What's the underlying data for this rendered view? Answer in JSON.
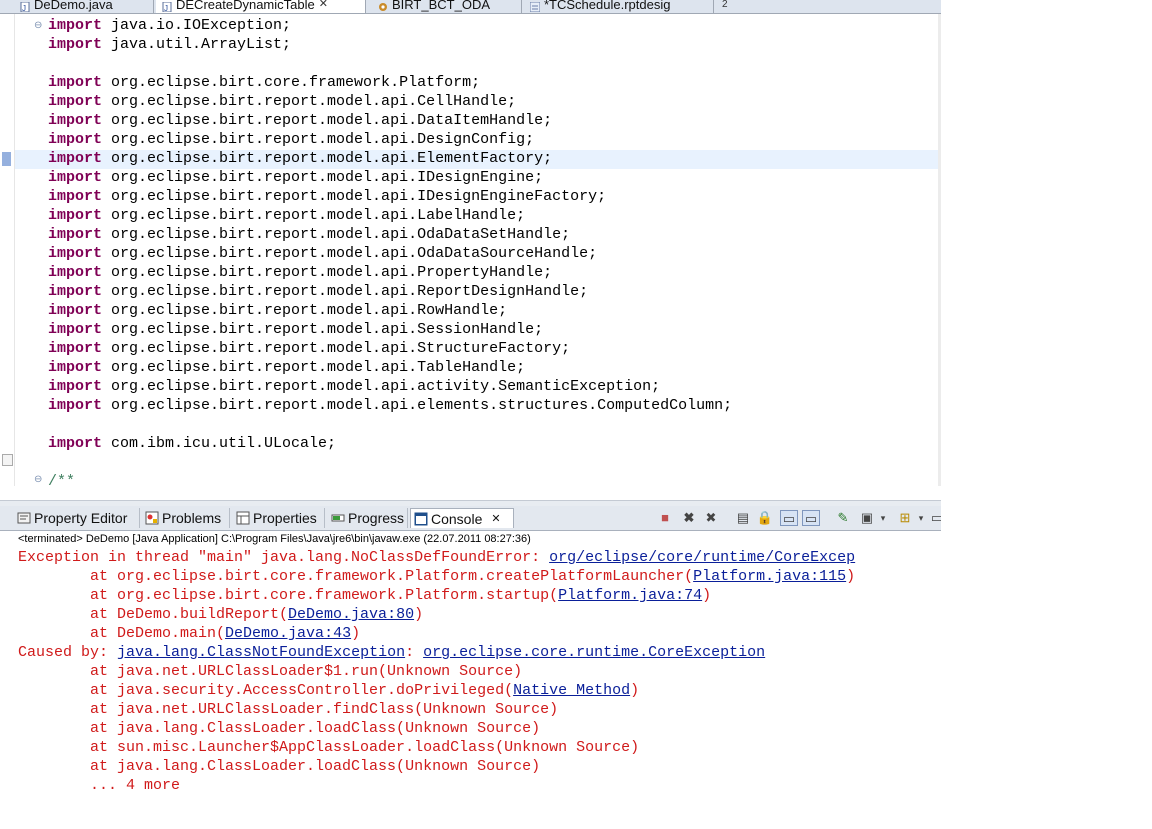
{
  "editor_tabs": [
    {
      "label": "DeDemo.java",
      "icon": "java-file-icon",
      "active": false
    },
    {
      "label": "DECreateDynamicTable",
      "icon": "java-file-icon",
      "active": true,
      "close": "✕"
    },
    {
      "label": "BIRT_BCT_ODA",
      "icon": "gear-icon",
      "active": false
    },
    {
      "label": "*TCSchedule.rptdesig",
      "icon": "report-design-icon",
      "active": false
    },
    {
      "label": "2",
      "icon": "",
      "active": false
    }
  ],
  "code": {
    "keyword": "import",
    "lines": [
      {
        "kw": "import",
        "text": " java.io.IOException;"
      },
      {
        "kw": "import",
        "text": " java.util.ArrayList;"
      },
      {
        "kw": "",
        "text": ""
      },
      {
        "kw": "import",
        "text": " org.eclipse.birt.core.framework.Platform;"
      },
      {
        "kw": "import",
        "text": " org.eclipse.birt.report.model.api.CellHandle;"
      },
      {
        "kw": "import",
        "text": " org.eclipse.birt.report.model.api.DataItemHandle;"
      },
      {
        "kw": "import",
        "text": " org.eclipse.birt.report.model.api.DesignConfig;"
      },
      {
        "kw": "import",
        "text": " org.eclipse.birt.report.model.api.ElementFactory;"
      },
      {
        "kw": "import",
        "text": " org.eclipse.birt.report.model.api.IDesignEngine;"
      },
      {
        "kw": "import",
        "text": " org.eclipse.birt.report.model.api.IDesignEngineFactory;"
      },
      {
        "kw": "import",
        "text": " org.eclipse.birt.report.model.api.LabelHandle;"
      },
      {
        "kw": "import",
        "text": " org.eclipse.birt.report.model.api.OdaDataSetHandle;"
      },
      {
        "kw": "import",
        "text": " org.eclipse.birt.report.model.api.OdaDataSourceHandle;"
      },
      {
        "kw": "import",
        "text": " org.eclipse.birt.report.model.api.PropertyHandle;"
      },
      {
        "kw": "import",
        "text": " org.eclipse.birt.report.model.api.ReportDesignHandle;"
      },
      {
        "kw": "import",
        "text": " org.eclipse.birt.report.model.api.RowHandle;"
      },
      {
        "kw": "import",
        "text": " org.eclipse.birt.report.model.api.SessionHandle;"
      },
      {
        "kw": "import",
        "text": " org.eclipse.birt.report.model.api.StructureFactory;"
      },
      {
        "kw": "import",
        "text": " org.eclipse.birt.report.model.api.TableHandle;"
      },
      {
        "kw": "import",
        "text": " org.eclipse.birt.report.model.api.activity.SemanticException;"
      },
      {
        "kw": "import",
        "text": " org.eclipse.birt.report.model.api.elements.structures.ComputedColumn;"
      },
      {
        "kw": "",
        "text": ""
      },
      {
        "kw": "import",
        "text": " com.ibm.icu.util.ULocale;"
      },
      {
        "kw": "",
        "text": ""
      },
      {
        "kw": "",
        "text": "/**",
        "comment": true
      }
    ]
  },
  "views": {
    "tabs": [
      {
        "label": "Property Editor",
        "icon": "property-editor-icon"
      },
      {
        "label": "Problems",
        "icon": "problems-icon"
      },
      {
        "label": "Properties",
        "icon": "properties-icon"
      },
      {
        "label": "Progress",
        "icon": "progress-icon"
      },
      {
        "label": "Console",
        "icon": "console-icon",
        "active": true,
        "close": "✕"
      }
    ]
  },
  "console": {
    "terminated": "<terminated> DeDemo [Java Application] C:\\Program Files\\Java\\jre6\\bin\\javaw.exe (22.07.2011 08:27:36)",
    "lines": [
      {
        "pre": "Exception in thread \"main\" java.lang.NoClassDefFoundError: ",
        "link": "org/eclipse/core/runtime/CoreExcep",
        "post": ""
      },
      {
        "pre": "        at org.eclipse.birt.core.framework.Platform.createPlatformLauncher(",
        "link": "Platform.java:115",
        "post": ")"
      },
      {
        "pre": "        at org.eclipse.birt.core.framework.Platform.startup(",
        "link": "Platform.java:74",
        "post": ")"
      },
      {
        "pre": "        at DeDemo.buildReport(",
        "link": "DeDemo.java:80",
        "post": ")"
      },
      {
        "pre": "        at DeDemo.main(",
        "link": "DeDemo.java:43",
        "post": ")"
      },
      {
        "pre": "Caused by: ",
        "link": "java.lang.ClassNotFoundException",
        "post": ": ",
        "link2": "org.eclipse.core.runtime.CoreException"
      },
      {
        "pre": "        at java.net.URLClassLoader$1.run(Unknown Source)",
        "link": "",
        "post": ""
      },
      {
        "pre": "        at java.security.AccessController.doPrivileged(",
        "link": "Native Method",
        "post": ")"
      },
      {
        "pre": "        at java.net.URLClassLoader.findClass(Unknown Source)",
        "link": "",
        "post": ""
      },
      {
        "pre": "        at java.lang.ClassLoader.loadClass(Unknown Source)",
        "link": "",
        "post": ""
      },
      {
        "pre": "        at sun.misc.Launcher$AppClassLoader.loadClass(Unknown Source)",
        "link": "",
        "post": ""
      },
      {
        "pre": "        at java.lang.ClassLoader.loadClass(Unknown Source)",
        "link": "",
        "post": ""
      },
      {
        "pre": "        ... 4 more",
        "link": "",
        "post": ""
      }
    ]
  },
  "colors": {
    "keyword": "#7f0055",
    "error": "#d01a1a",
    "link": "#0a1f99",
    "current_line": "#e8f2fe"
  }
}
